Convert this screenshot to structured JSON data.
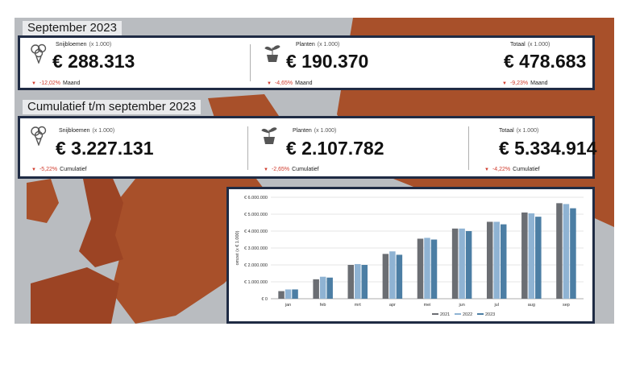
{
  "colors": {
    "panel_border": "#1f2b44",
    "negative": "#d03a2c",
    "map_land": "#a8502a",
    "sea": "#b9bcc0"
  },
  "month_section": {
    "title": "September 2023",
    "kpis": [
      {
        "icon": "flower-bouquet-icon",
        "label": "Snijbloemen",
        "unit": "(x 1.000)",
        "value": "€ 288.313",
        "change": "-12,02%",
        "change_label": "Maand"
      },
      {
        "icon": "potted-plant-icon",
        "label": "Planten",
        "unit": "(x 1.000)",
        "value": "€ 190.370",
        "change": "-4,65%",
        "change_label": "Maand"
      },
      {
        "icon": "",
        "label": "Totaal",
        "unit": "(x 1.000)",
        "value": "€ 478.683",
        "change": "-9,23%",
        "change_label": "Maand"
      }
    ]
  },
  "cumulative_section": {
    "title": "Cumulatief t/m september 2023",
    "kpis": [
      {
        "icon": "flower-bouquet-icon",
        "label": "Snijbloemen",
        "unit": "(x 1.000)",
        "value": "€ 3.227.131",
        "change": "-5,22%",
        "change_label": "Cumulatief"
      },
      {
        "icon": "potted-plant-icon",
        "label": "Planten",
        "unit": "(x 1.000)",
        "value": "€ 2.107.782",
        "change": "-2,65%",
        "change_label": "Cumulatief"
      },
      {
        "icon": "",
        "label": "Totaal",
        "unit": "(x 1.000)",
        "value": "€ 5.334.914",
        "change": "-4,22%",
        "change_label": "Cumulatief"
      }
    ]
  },
  "chart_data": {
    "type": "bar",
    "categories": [
      "jan",
      "feb",
      "mrt",
      "apr",
      "mei",
      "jun",
      "jul",
      "aug",
      "sep"
    ],
    "series": [
      {
        "name": "2021",
        "color": "#6b6e73",
        "values": [
          450000,
          1150000,
          2000000,
          2650000,
          3550000,
          4150000,
          4550000,
          5100000,
          5650000
        ]
      },
      {
        "name": "2022",
        "color": "#8fb3d3",
        "values": [
          550000,
          1300000,
          2050000,
          2800000,
          3600000,
          4150000,
          4550000,
          5050000,
          5600000
        ]
      },
      {
        "name": "2023",
        "color": "#4c7ea4",
        "values": [
          550000,
          1250000,
          2000000,
          2600000,
          3500000,
          4000000,
          4400000,
          4850000,
          5350000
        ]
      }
    ],
    "ylabel": "omzet (x € 1.000)",
    "yticks": [
      "€ 0",
      "€ 1.000.000",
      "€ 2.000.000",
      "€ 3.000.000",
      "€ 4.000.000",
      "€ 5.000.000",
      "€ 6.000.000"
    ],
    "ylim": [
      0,
      6000000
    ],
    "grid": true,
    "legend": "bottom-center"
  }
}
